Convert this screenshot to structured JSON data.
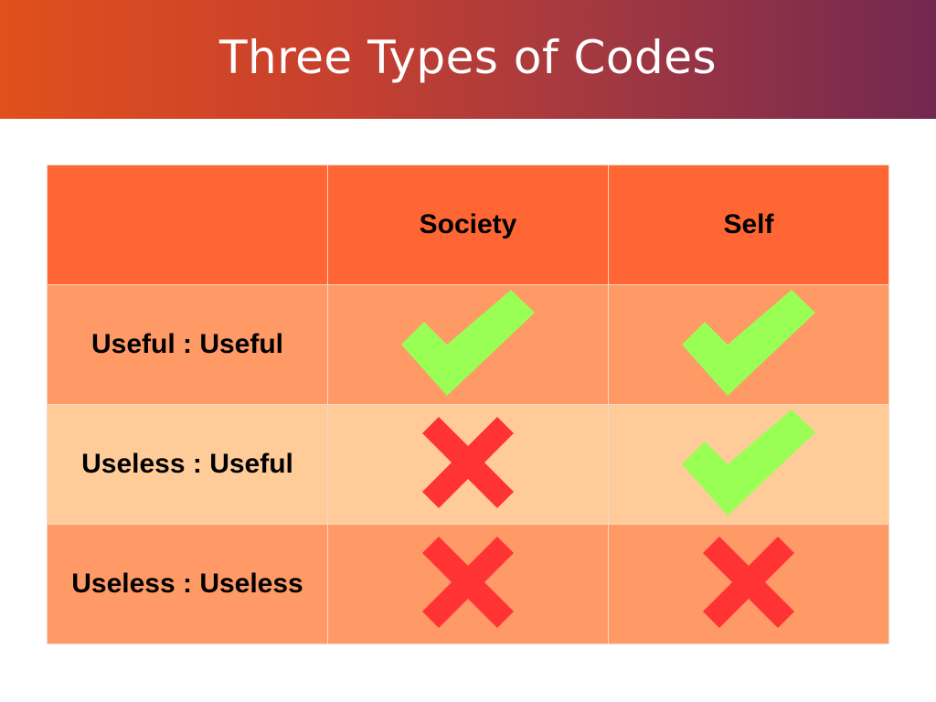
{
  "slide": {
    "title": "Three Types of Codes"
  },
  "table": {
    "columns": [
      "",
      "Society",
      "Self"
    ],
    "rows": [
      {
        "label": "Useful : Useful",
        "society": "check",
        "self": "check"
      },
      {
        "label": "Useless : Useful",
        "society": "cross",
        "self": "check"
      },
      {
        "label": "Useless : Useless",
        "society": "cross",
        "self": "cross"
      }
    ]
  },
  "icons": {
    "check": "check-mark-icon",
    "cross": "cross-mark-icon"
  },
  "colors": {
    "title_gradient_start": "#e0501c",
    "title_gradient_end": "#732850",
    "header_fill": "#ff6633",
    "row_dark_fill": "#ff9966",
    "row_light_fill": "#ffcc99",
    "check_color": "#99ff55",
    "cross_color": "#ff3333"
  }
}
